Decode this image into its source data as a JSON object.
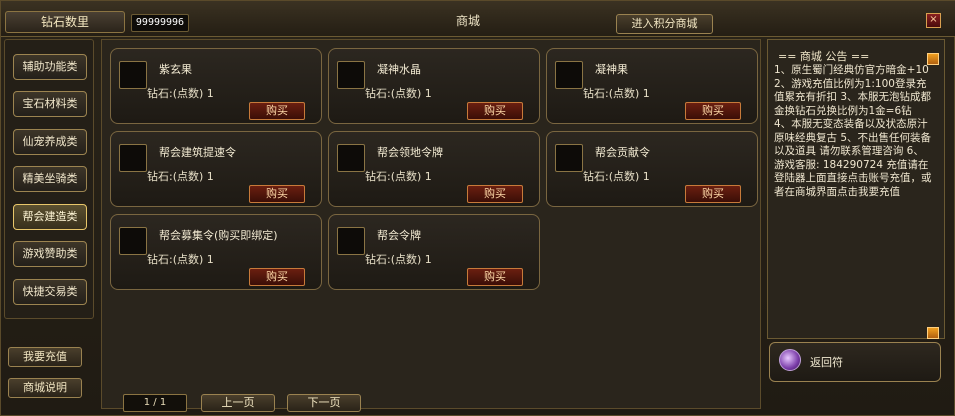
{
  "header": {
    "diamond_label": "钻石数里",
    "diamond_value": "99999996",
    "title": "商城",
    "points_shop_button": "进入积分商城",
    "close_icon": "×"
  },
  "categories": [
    {
      "label": "辅助功能类"
    },
    {
      "label": "宝石材料类"
    },
    {
      "label": "仙宠养成类"
    },
    {
      "label": "精美坐骑类"
    },
    {
      "label": "帮会建造类",
      "active": true
    },
    {
      "label": "游戏赞助类"
    },
    {
      "label": "快捷交易类"
    }
  ],
  "sidebar_extra": {
    "recharge_button": "我要充值",
    "shop_help_button": "商城说明"
  },
  "items": [
    {
      "name": "紫玄果",
      "price": "钻石:(点数) 1",
      "buy": "购买",
      "icon": "fruit-icon"
    },
    {
      "name": "凝神水晶",
      "price": "钻石:(点数) 1",
      "buy": "购买",
      "icon": "fire-crystal-icon"
    },
    {
      "name": "凝神果",
      "price": "钻石:(点数) 1",
      "buy": "购买",
      "icon": "red-fruit-icon"
    },
    {
      "name": "帮会建筑提速令",
      "price": "钻石:(点数) 1",
      "buy": "购买",
      "icon": "scroll-icon"
    },
    {
      "name": "帮会领地令牌",
      "price": "钻石:(点数) 1",
      "buy": "购买",
      "icon": "token-icon"
    },
    {
      "name": "帮会贡献令",
      "price": "钻石:(点数) 1",
      "buy": "购买",
      "icon": "badge-icon"
    },
    {
      "name": "帮会募集令(购买即绑定)",
      "price": "钻石:(点数) 1",
      "buy": "购买",
      "icon": "banner-icon"
    },
    {
      "name": "帮会令牌",
      "price": "钻石:(点数) 1",
      "buy": "购买",
      "icon": "tag-icon"
    }
  ],
  "pager": {
    "page": "1 / 1",
    "prev": "上一页",
    "next": "下一页"
  },
  "notice": {
    "title": "== 商城 公告 ==",
    "body": "1、原生蜀门经典仿官方暗金+10  2、游戏充值比例为1:100登录充值累充有折扣 3、本服无泡钻成都金换钻石兑换比例为1金=6钻  4、本服无变态装备以及状态原汁原味经典复古  5、不出售任何装备以及道具      请勿联系管理咨询  6、游戏客服: 184290724    充值请在登陆器上面直接点击账号充值，或者在商城界面点击我要充值"
  },
  "return_item": {
    "label": "返回符",
    "icon": "return-orb-icon"
  }
}
